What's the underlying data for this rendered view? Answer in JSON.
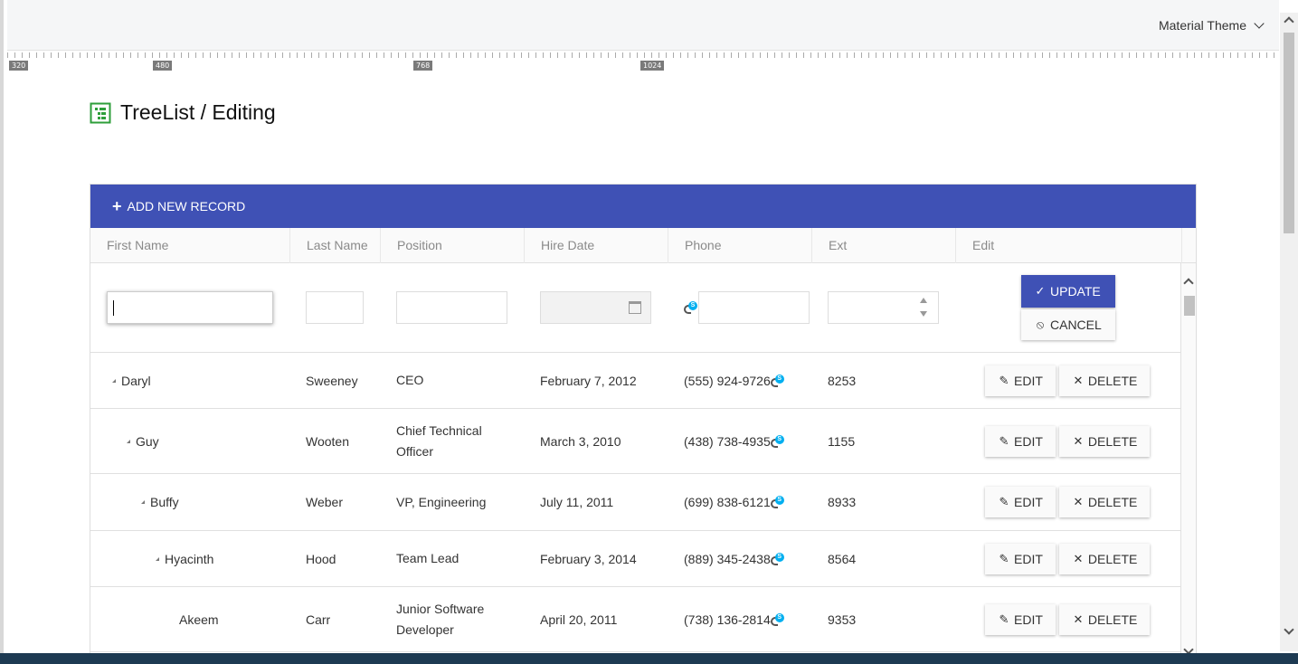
{
  "topbar": {
    "theme_label": "Material Theme"
  },
  "ruler": {
    "marks": [
      "320",
      "480",
      "768",
      "1024"
    ]
  },
  "page": {
    "title": "TreeList / Editing"
  },
  "toolbar": {
    "add_label": "ADD NEW RECORD"
  },
  "columns": [
    "First Name",
    "Last Name",
    "Position",
    "Hire Date",
    "Phone",
    "Ext",
    "Edit"
  ],
  "edit_row": {
    "update_label": "UPDATE",
    "cancel_label": "CANCEL"
  },
  "row_buttons": {
    "edit_label": "EDIT",
    "delete_label": "DELETE"
  },
  "rows": [
    {
      "first": "Daryl",
      "last": "Sweeney",
      "position": "CEO",
      "hire": "February 7, 2012",
      "phone": "(555) 924-9726",
      "ext": "8253",
      "level": 0,
      "expanded": true
    },
    {
      "first": "Guy",
      "last": "Wooten",
      "position": "Chief Technical Officer",
      "hire": "March 3, 2010",
      "phone": "(438) 738-4935",
      "ext": "1155",
      "level": 1,
      "expanded": true
    },
    {
      "first": "Buffy",
      "last": "Weber",
      "position": "VP, Engineering",
      "hire": "July 11, 2011",
      "phone": "(699) 838-6121",
      "ext": "8933",
      "level": 2,
      "expanded": true
    },
    {
      "first": "Hyacinth",
      "last": "Hood",
      "position": "Team Lead",
      "hire": "February 3, 2014",
      "phone": "(889) 345-2438",
      "ext": "8564",
      "level": 3,
      "expanded": true
    },
    {
      "first": "Akeem",
      "last": "Carr",
      "position": "Junior Software Developer",
      "hire": "April 20, 2011",
      "phone": "(738) 136-2814",
      "ext": "9353",
      "level": 4,
      "expanded": false
    }
  ]
}
